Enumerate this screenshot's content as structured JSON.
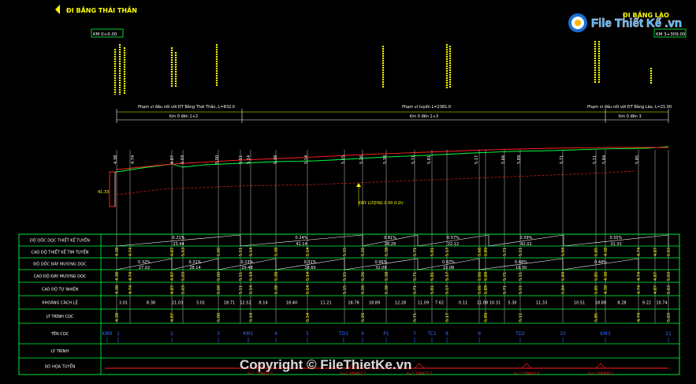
{
  "header": {
    "left_title": "ĐI BẮNG THÁI THẦN",
    "right_title": "ĐI BẮNG LÀO",
    "start_station": "KM 0+0.00",
    "end_station": "KM 3+309.00"
  },
  "sections": [
    {
      "label": "Phạm vi đầu nối với ĐT Bằng Thái Thần, L=832.0",
      "km": "Km 0 đến 1+2"
    },
    {
      "label": "Phạm vi tuyến L=2381.0",
      "km": "Km 0 đến 1+3"
    },
    {
      "label": "Phạm vi đầu nối với ĐT Bằng Lào, L=21.00",
      "km": "Km 0 đến 3"
    }
  ],
  "annotations": {
    "left_level": "41.33",
    "water_level": "ĐÁY LƯỢNG 0.00 0.2U"
  },
  "table_rows": [
    "ĐỘ DỐC DỌC THIẾT KẾ TUYẾN",
    "CAO ĐỘ THIẾT KẾ TIM TUYẾN",
    "ĐỘ DỐC ĐÁY MƯƠNG DỌC",
    "CAO ĐỘ ĐÁY MƯƠNG DỌC",
    "CAO ĐỘ TỰ NHIÊN",
    "KHOẢNG CÁCH LẺ",
    "LÝ TRÌNH CỌC",
    "TÊN CỌC",
    "LÝ TRÌNH",
    "SƠ HỌA TUYẾN"
  ],
  "grade_values": [
    "0.21%",
    "0.24%",
    "0.81%",
    "0.57%",
    "0.59%",
    "0.55%"
  ],
  "grade_lengths": [
    "23.44",
    "41.14",
    "28.28",
    "22.12",
    "42.02",
    "31.33"
  ],
  "ditch_grades": [
    "0.32%",
    "0.21%",
    "0.23%",
    "0.31%",
    "0.95%",
    "0.87%",
    "0.66%",
    "0.44%"
  ],
  "ditch_lengths": [
    "27.02",
    "28.14",
    "29.48",
    "18.60",
    "32.08",
    "22.08",
    "19.30"
  ],
  "profile_values": [
    "4.38",
    "4.74",
    "4.87",
    "5.03",
    "5.00",
    "5.11",
    "5.14",
    "5.38",
    "5.14",
    "5.15",
    "5.26",
    "5.38",
    "5.71",
    "5.81",
    "5.17",
    "5.66",
    "5.89",
    "5.71",
    "5.11",
    "5.84",
    "5.85"
  ],
  "distances": [
    "3.01",
    "8.38",
    "21.03",
    "3.01",
    "18.71",
    "12.52",
    "8.14",
    "18.40",
    "11.21",
    "18.78",
    "18.89",
    "12.28",
    "11.09",
    "7.62",
    "0.11",
    "11.08",
    "10.31",
    "5.30",
    "11.33",
    "10.51",
    "18.80",
    "8.28",
    "9.22",
    "10.74"
  ],
  "stake_names": [
    "KM0",
    "1",
    "2",
    "3",
    "KM1",
    "4",
    "5",
    "TD1",
    "6",
    "P1",
    "7",
    "TC1",
    "8",
    "9",
    "TD2",
    "10",
    "KM3",
    "11"
  ],
  "bottom_labels": [
    "A=1 108431.1",
    "A=1 108462.1",
    "A=1 108473.3",
    "A=1 108420.0",
    "A=1 108408.1"
  ],
  "watermark": {
    "brand": "File Thiết Kế .vn",
    "copyright": "Copyright © FileThietKe.vn"
  }
}
